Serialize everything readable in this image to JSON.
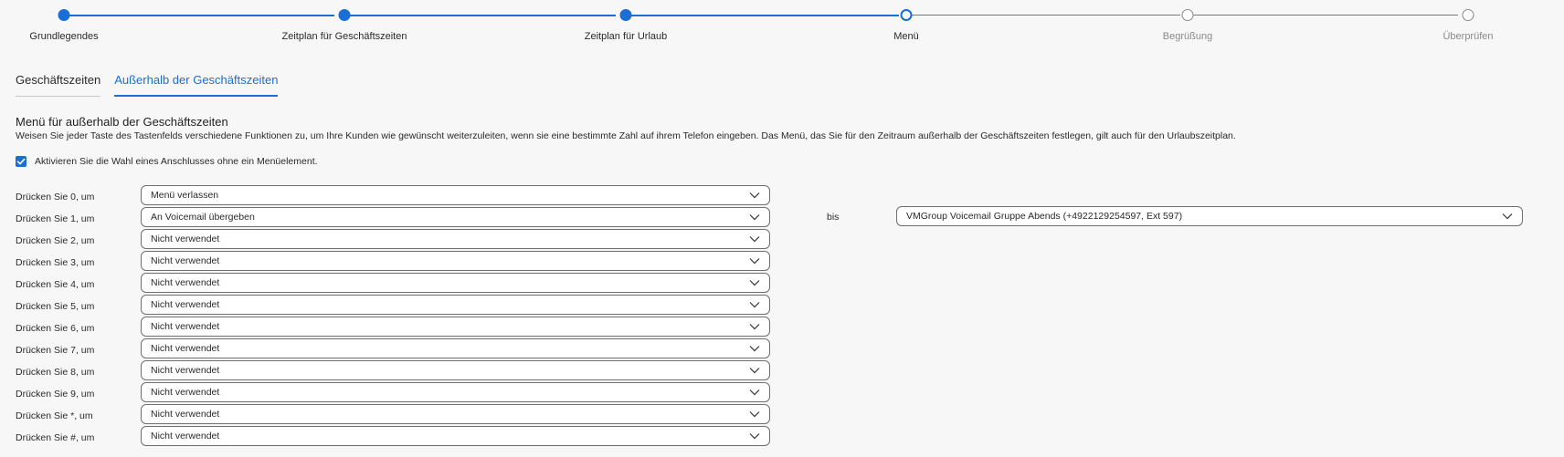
{
  "stepper": {
    "steps": [
      {
        "label": "Grundlegendes",
        "state": "done"
      },
      {
        "label": "Zeitplan für Geschäftszeiten",
        "state": "done"
      },
      {
        "label": "Zeitplan für Urlaub",
        "state": "done"
      },
      {
        "label": "Menü",
        "state": "current"
      },
      {
        "label": "Begrüßung",
        "state": "todo"
      },
      {
        "label": "Überprüfen",
        "state": "todo"
      }
    ]
  },
  "tabs": [
    {
      "label": "Geschäftszeiten",
      "active": false
    },
    {
      "label": "Außerhalb der Geschäftszeiten",
      "active": true
    }
  ],
  "section": {
    "title": "Menü für außerhalb der Geschäftszeiten",
    "description": "Weisen Sie jeder Taste des Tastenfelds verschiedene Funktionen zu, um Ihre Kunden wie gewünscht weiterzuleiten, wenn sie eine bestimmte Zahl auf ihrem Telefon eingeben. Das Menü, das Sie für den Zeitraum außerhalb der Geschäftszeiten festlegen, gilt auch für den Urlaubszeitplan.",
    "checkbox_label": "Aktivieren Sie die Wahl eines Anschlusses ohne ein Menüelement.",
    "checkbox_checked": true
  },
  "key_rows": [
    {
      "label": "Drücken Sie 0, um",
      "value": "Menü verlassen"
    },
    {
      "label": "Drücken Sie 1, um",
      "value": "An Voicemail übergeben"
    },
    {
      "label": "Drücken Sie 2, um",
      "value": "Nicht verwendet"
    },
    {
      "label": "Drücken Sie 3, um",
      "value": "Nicht verwendet"
    },
    {
      "label": "Drücken Sie 4, um",
      "value": "Nicht verwendet"
    },
    {
      "label": "Drücken Sie 5, um",
      "value": "Nicht verwendet"
    },
    {
      "label": "Drücken Sie 6, um",
      "value": "Nicht verwendet"
    },
    {
      "label": "Drücken Sie 7, um",
      "value": "Nicht verwendet"
    },
    {
      "label": "Drücken Sie 8, um",
      "value": "Nicht verwendet"
    },
    {
      "label": "Drücken Sie 9, um",
      "value": "Nicht verwendet"
    },
    {
      "label": "Drücken Sie *, um",
      "value": "Nicht verwendet"
    },
    {
      "label": "Drücken Sie #, um",
      "value": "Nicht verwendet"
    }
  ],
  "destination": {
    "bis_label": "bis",
    "value": "VMGroup Voicemail Gruppe Abends (+4922129254597, Ext 597)"
  },
  "colors": {
    "accent": "#1b6ed4",
    "background": "#f7f7f7",
    "text": "#1f1f1f",
    "inactive_step": "#8a8a8a"
  }
}
